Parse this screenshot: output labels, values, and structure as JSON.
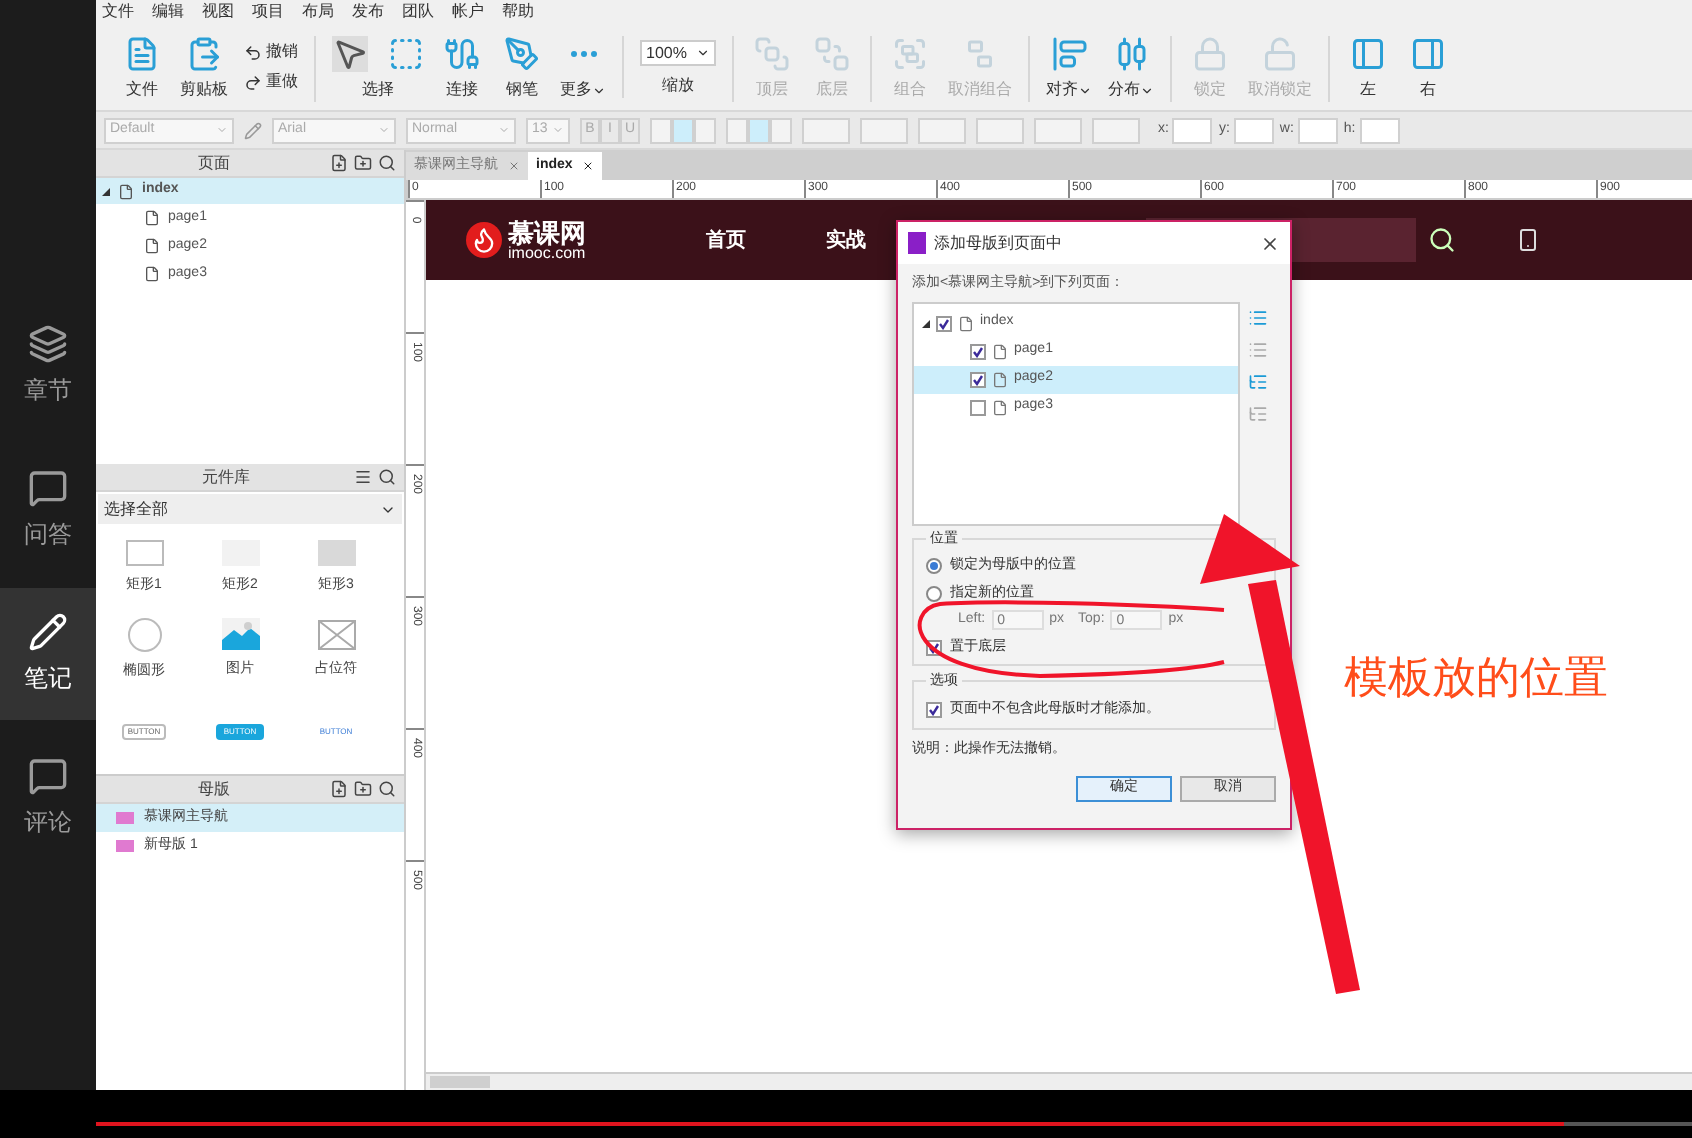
{
  "sidebar": {
    "items": [
      {
        "label": "章节",
        "selected": false
      },
      {
        "label": "问答",
        "selected": false
      },
      {
        "label": "笔记",
        "selected": true
      },
      {
        "label": "评论",
        "selected": false
      }
    ]
  },
  "menu": [
    "文件",
    "编辑",
    "视图",
    "项目",
    "布局",
    "发布",
    "团队",
    "帐户",
    "帮助"
  ],
  "toolbar": {
    "groups": [
      {
        "items": [
          {
            "kind": "tool",
            "label": "文件",
            "disabled": false,
            "dropdown": false
          },
          {
            "kind": "tool",
            "label": "剪贴板",
            "disabled": false,
            "dropdown": false
          },
          {
            "kind": "history",
            "undo": "撤销",
            "redo": "重做"
          }
        ]
      },
      {
        "items": [
          {
            "kind": "select",
            "label": "选择"
          },
          {
            "kind": "tool",
            "label": "连接",
            "disabled": false,
            "dropdown": false
          },
          {
            "kind": "tool",
            "label": "钢笔",
            "disabled": false,
            "dropdown": false
          },
          {
            "kind": "tool",
            "label": "更多",
            "disabled": false,
            "dropdown": true
          }
        ]
      },
      {
        "items": [
          {
            "kind": "zoom",
            "value": "100%",
            "label": "缩放"
          }
        ]
      },
      {
        "items": [
          {
            "kind": "tool",
            "label": "顶层",
            "disabled": true,
            "dropdown": false
          },
          {
            "kind": "tool",
            "label": "底层",
            "disabled": true,
            "dropdown": false
          }
        ]
      },
      {
        "items": [
          {
            "kind": "tool",
            "label": "组合",
            "disabled": true,
            "dropdown": false
          },
          {
            "kind": "tool",
            "label": "取消组合",
            "disabled": true,
            "dropdown": false
          }
        ]
      },
      {
        "items": [
          {
            "kind": "tool",
            "label": "对齐",
            "disabled": false,
            "dropdown": true
          },
          {
            "kind": "tool",
            "label": "分布",
            "disabled": false,
            "dropdown": true
          }
        ]
      },
      {
        "items": [
          {
            "kind": "tool",
            "label": "锁定",
            "disabled": true,
            "dropdown": false
          },
          {
            "kind": "tool",
            "label": "取消锁定",
            "disabled": true,
            "dropdown": false
          }
        ]
      },
      {
        "items": [
          {
            "kind": "tool",
            "label": "左",
            "disabled": false,
            "dropdown": false
          },
          {
            "kind": "tool",
            "label": "右",
            "disabled": false,
            "dropdown": false
          }
        ]
      }
    ]
  },
  "format": {
    "style": "Default",
    "font": "Arial",
    "weight": "Normal",
    "size": "13",
    "text_buttons": [
      "B",
      "I",
      "U"
    ],
    "h_align": [
      {
        "selected": false
      },
      {
        "selected": true
      },
      {
        "selected": false
      }
    ],
    "v_align": [
      {
        "selected": false
      },
      {
        "selected": true
      },
      {
        "selected": false
      }
    ],
    "coords": [
      "x:",
      "y:",
      "w:",
      "h:"
    ]
  },
  "pages": {
    "title": "页面",
    "tree": [
      {
        "label": "index",
        "expanded": true,
        "selected": true,
        "children": [
          {
            "label": "page1",
            "selected": false
          },
          {
            "label": "page2",
            "selected": false
          },
          {
            "label": "page3",
            "selected": false
          }
        ]
      }
    ]
  },
  "library": {
    "title": "元件库",
    "filter": "选择全部",
    "widgets": [
      {
        "kind": "rect-outline",
        "label": "矩形1"
      },
      {
        "kind": "rect-light",
        "label": "矩形2"
      },
      {
        "kind": "rect-gray",
        "label": "矩形3"
      },
      {
        "kind": "ellipse",
        "label": "椭圆形"
      },
      {
        "kind": "image",
        "label": "图片"
      },
      {
        "kind": "placeholder",
        "label": "占位符"
      },
      {
        "kind": "button-outline",
        "text": "BUTTON"
      },
      {
        "kind": "button-primary",
        "text": "BUTTON"
      },
      {
        "kind": "button-link",
        "text": "BUTTON"
      }
    ]
  },
  "masters": {
    "title": "母版",
    "items": [
      {
        "label": "慕课网主导航",
        "selected": true
      },
      {
        "label": "新母版 1",
        "selected": false
      }
    ]
  },
  "canvas": {
    "tabs": [
      {
        "label": "慕课网主导航",
        "selected": false
      },
      {
        "label": "index",
        "selected": true
      }
    ],
    "h_ruler": [
      "0",
      "100",
      "200",
      "300",
      "400",
      "500",
      "600",
      "700",
      "800",
      "900"
    ],
    "v_ruler": [
      "0",
      "100",
      "200",
      "300",
      "400",
      "500"
    ],
    "site_nav": {
      "logo_title": "慕课网",
      "logo_sub": "imooc.com",
      "links": [
        "首页",
        "实战"
      ]
    }
  },
  "dialog": {
    "title": "添加母版到页面中",
    "instruction": "添加<慕课网主导航>到下列页面：",
    "tree": [
      {
        "label": "index",
        "checked": true,
        "selected": false,
        "expanded": true,
        "children": [
          {
            "label": "page1",
            "checked": true,
            "selected": false
          },
          {
            "label": "page2",
            "checked": true,
            "selected": true
          },
          {
            "label": "page3",
            "checked": false,
            "selected": false
          }
        ]
      }
    ],
    "position": {
      "title": "位置",
      "options": [
        {
          "label": "锁定为母版中的位置",
          "selected": true
        },
        {
          "label": "指定新的位置",
          "selected": false
        }
      ],
      "left_label": "Left:",
      "left_value": "0",
      "left_unit": "px",
      "top_label": "Top:",
      "top_value": "0",
      "top_unit": "px",
      "bottom_layer": {
        "label": "置于底层",
        "checked": true
      }
    },
    "options": {
      "title": "选项",
      "only_if_absent": {
        "label": "页面中不包含此母版时才能添加。",
        "checked": true
      }
    },
    "note": "说明：此操作无法撤销。",
    "ok": "确定",
    "cancel": "取消"
  },
  "annotation": "模板放的位置",
  "video": {
    "progress": {
      "level": 0.92
    }
  }
}
